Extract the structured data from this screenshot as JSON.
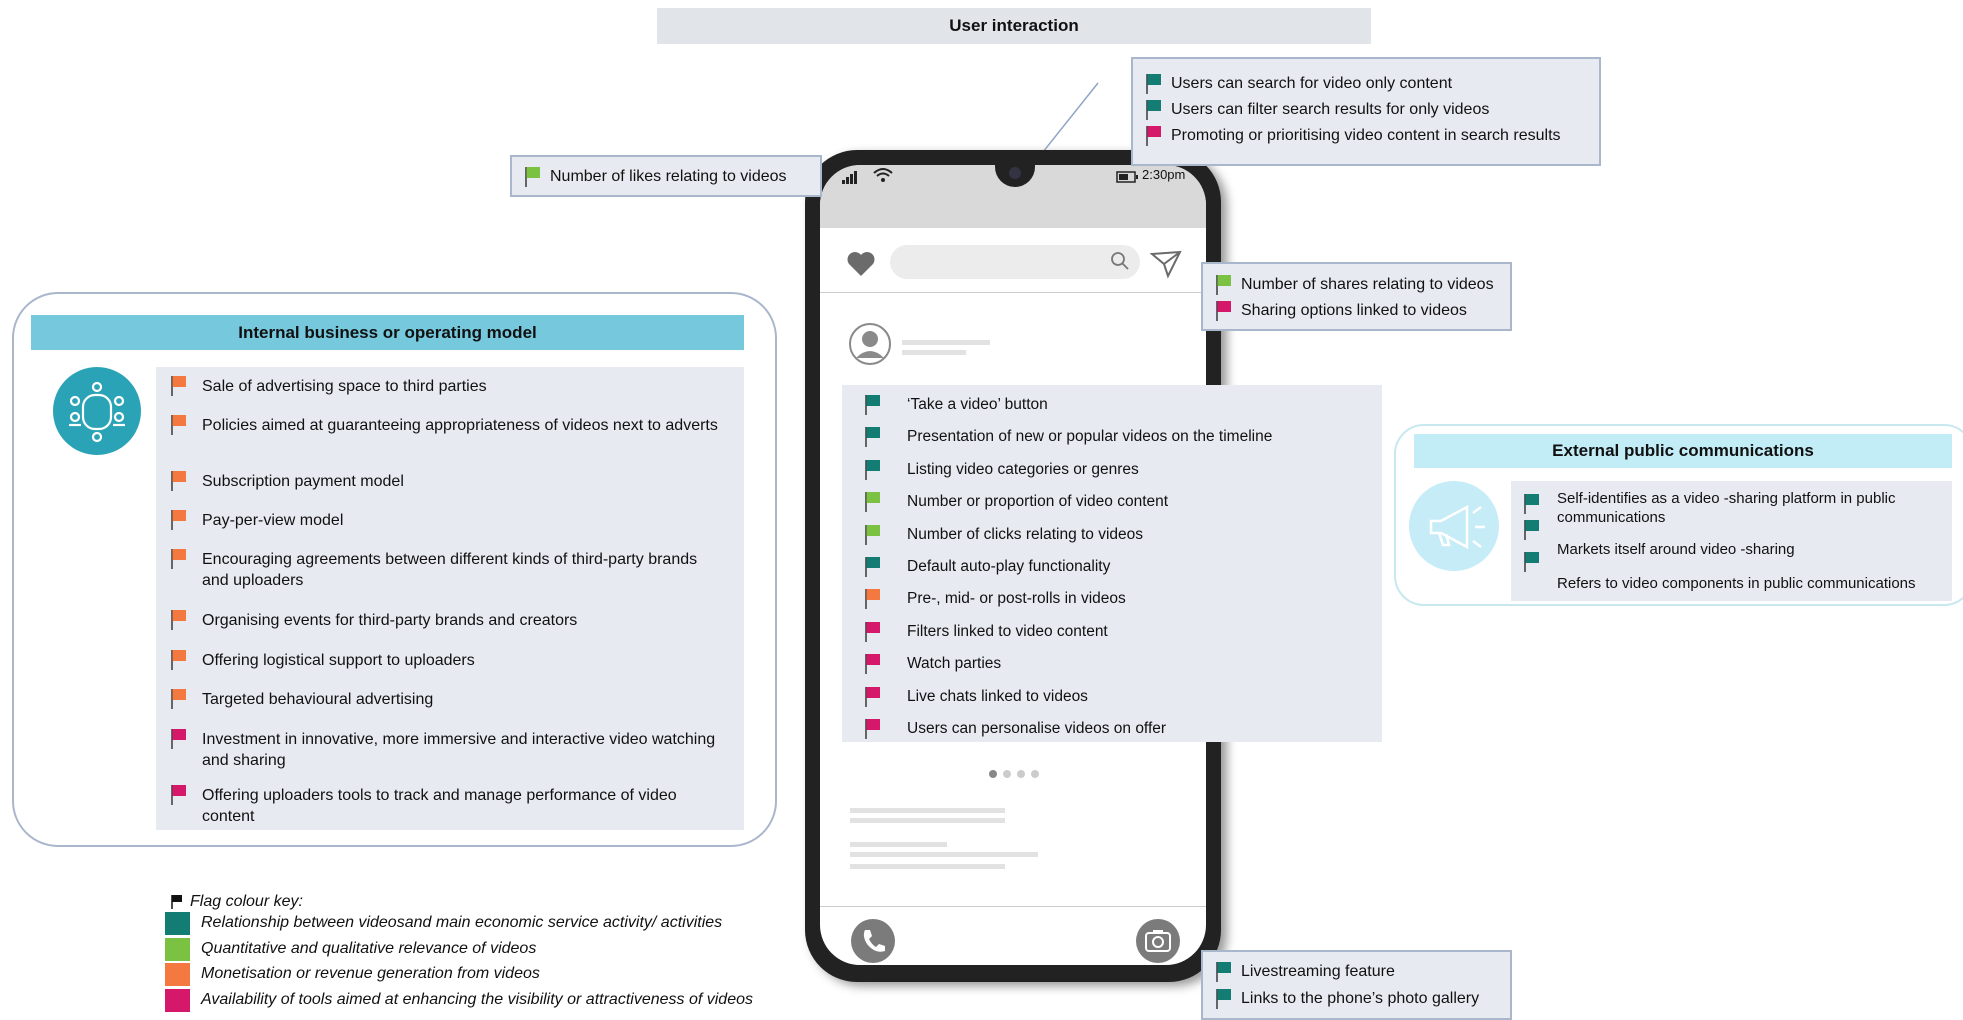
{
  "colors": {
    "teal": "#147d73",
    "green": "#7cc242",
    "orange": "#f47940",
    "magenta": "#d6186b"
  },
  "title": "User interaction",
  "callouts": {
    "search": {
      "items": [
        {
          "text": "Users can search for video only content",
          "color": "teal"
        },
        {
          "text": "Users can filter search results for only videos",
          "color": "teal"
        },
        {
          "text": "Promoting or prioritising video content in search results",
          "color": "magenta"
        }
      ]
    },
    "likes": {
      "items": [
        {
          "text": "Number of likes relating to videos",
          "color": "green"
        }
      ]
    },
    "shares": {
      "items": [
        {
          "text": "Number of shares relating to videos",
          "color": "green"
        },
        {
          "text": "Sharing options linked to videos",
          "color": "magenta"
        }
      ]
    },
    "camera": {
      "items": [
        {
          "text": "Livestreaming feature",
          "color": "teal"
        },
        {
          "text": "Links to the phone’s photo gallery",
          "color": "teal"
        }
      ]
    }
  },
  "phone": {
    "time": "2:30pm",
    "screen_items": [
      {
        "text": "‘Take a video’ button",
        "color": "teal"
      },
      {
        "text": "Presentation of new or popular videos on the timeline",
        "color": "teal"
      },
      {
        "text": "Listing video categories or genres",
        "color": "teal"
      },
      {
        "text": "Number or proportion of video content",
        "color": "green"
      },
      {
        "text": "Number of clicks relating to videos",
        "color": "green"
      },
      {
        "text": "Default auto-play functionality",
        "color": "teal"
      },
      {
        "text": "Pre-, mid- or post-rolls in videos",
        "color": "orange"
      },
      {
        "text": "Filters linked to video content",
        "color": "magenta"
      },
      {
        "text": "Watch parties",
        "color": "magenta"
      },
      {
        "text": "Live chats linked to videos",
        "color": "magenta"
      },
      {
        "text": "Users can personalise videos on offer",
        "color": "magenta"
      }
    ]
  },
  "internal": {
    "title": "Internal business or operating model",
    "icon": "boardroom-icon",
    "items": [
      {
        "text": "Sale of advertising space to third parties",
        "color": "orange"
      },
      {
        "text": "Policies aimed at guaranteeing appropriateness of videos next to adverts",
        "color": "orange"
      },
      {
        "text": "Subscription payment model",
        "color": "orange"
      },
      {
        "text": "Pay-per-view model",
        "color": "orange"
      },
      {
        "text": "Encouraging agreements between different kinds of third-party brands and uploaders",
        "color": "orange"
      },
      {
        "text": "Organising events for third-party brands and creators",
        "color": "orange"
      },
      {
        "text": "Offering logistical support to uploaders",
        "color": "orange"
      },
      {
        "text": "Targeted behavioural advertising",
        "color": "orange"
      },
      {
        "text": "Investment in innovative, more immersive  and interactive video watching and sharing",
        "color": "magenta"
      },
      {
        "text": "Offering uploaders tools to track and manage performance of video content",
        "color": "magenta"
      }
    ]
  },
  "external": {
    "title": "External public communications",
    "icon": "megaphone-icon",
    "items": [
      {
        "text": "Self-identifies as a video -sharing platform in public communications",
        "color": "teal"
      },
      {
        "text": "Markets itself around video  -sharing",
        "color": "teal"
      },
      {
        "text": "Refers to video components in public   communications",
        "color": "teal"
      }
    ]
  },
  "key": {
    "title": "Flag colour key:",
    "items": [
      {
        "text": "Relationship between videosand main economic service activity/ activities",
        "color": "teal"
      },
      {
        "text": "Quantitative and qualitative relevance of videos",
        "color": "green"
      },
      {
        "text": "Monetisation or revenue generation from videos",
        "color": "orange"
      },
      {
        "text": "Availability of tools aimed at enhancing the visibility or attractiveness of videos",
        "color": "magenta"
      }
    ]
  }
}
